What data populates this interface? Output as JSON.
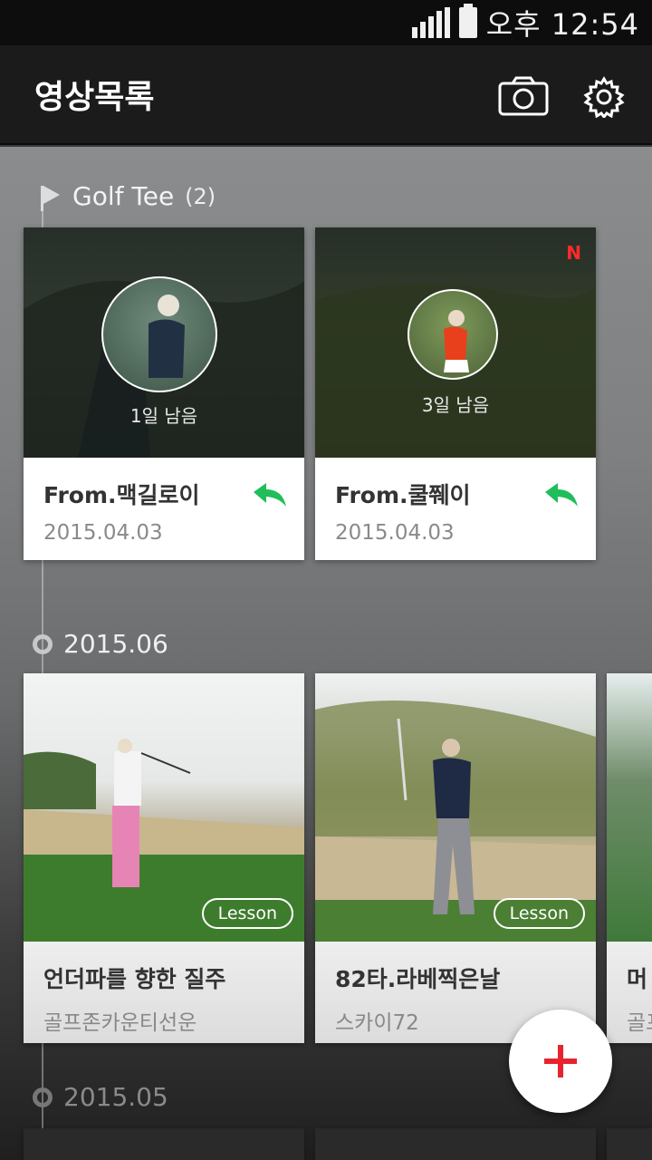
{
  "status": {
    "time": "오후 12:54"
  },
  "app": {
    "title": "영상목록"
  },
  "icons": {
    "camera": "camera-icon",
    "settings": "gear-icon",
    "add": "plus-icon",
    "reply": "reply-icon"
  },
  "colors": {
    "accent": "#e8232e",
    "reply": "#1fbe5a",
    "new": "#ff2a2a"
  },
  "sections": {
    "golf_tee": {
      "title": "Golf Tee",
      "count": "(2)"
    },
    "jun": {
      "date": "2015.06"
    },
    "may": {
      "date": "2015.05"
    }
  },
  "golf_tee_cards": [
    {
      "remaining": "1일 남음",
      "title": "From.맥길로이",
      "date": "2015.04.03",
      "is_new": false
    },
    {
      "remaining": "3일 남음",
      "title": "From.쿨쮀이",
      "date": "2015.04.03",
      "new_label": "N"
    }
  ],
  "jun_cards": [
    {
      "tag": "Lesson",
      "title": "언더파를 향한 질주",
      "subtitle": "골프존카운티선운"
    },
    {
      "tag": "Lesson",
      "title": "82타.라베찍은날",
      "subtitle": "스카이72"
    },
    {
      "title": "머",
      "subtitle": "골프"
    }
  ]
}
